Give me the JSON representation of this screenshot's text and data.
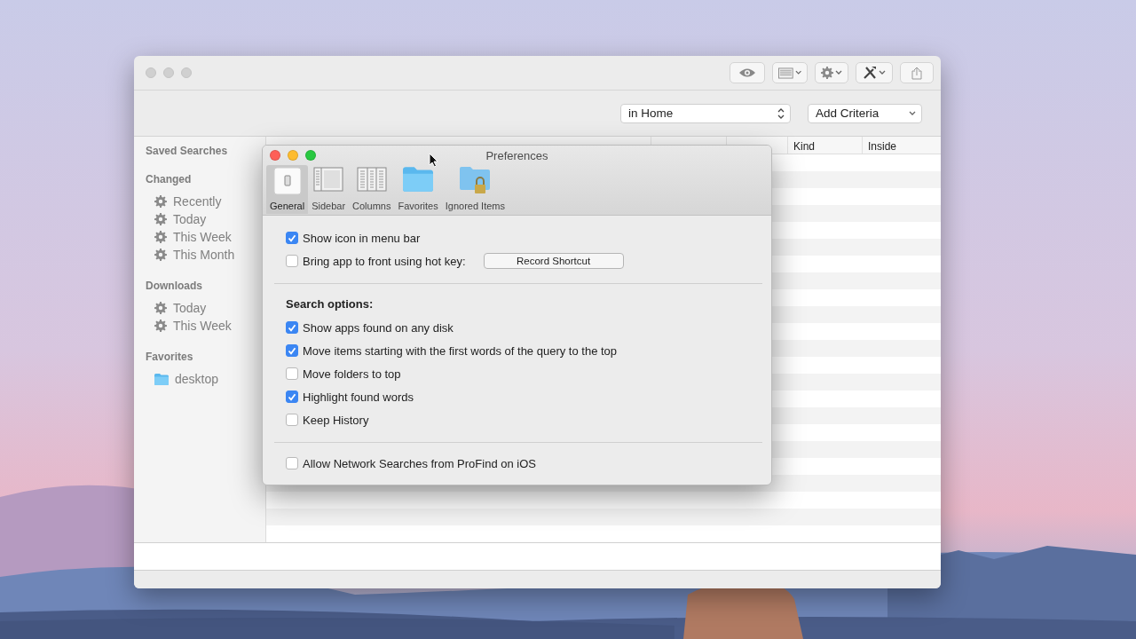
{
  "finder": {
    "scope": "in Home",
    "criteria": "Add Criteria",
    "sidebar": [
      {
        "title": "Saved Searches"
      },
      {
        "title": "Changed",
        "items": [
          {
            "label": "Recently",
            "kind": "search"
          },
          {
            "label": "Today",
            "kind": "search"
          },
          {
            "label": "This Week",
            "kind": "search"
          },
          {
            "label": "This Month",
            "kind": "search"
          }
        ]
      },
      {
        "title": "Downloads",
        "items": [
          {
            "label": "Today",
            "kind": "search"
          },
          {
            "label": "This Week",
            "kind": "search"
          }
        ]
      },
      {
        "title": "Favorites",
        "items": [
          {
            "label": "desktop",
            "kind": "folder"
          }
        ]
      }
    ],
    "columns": [
      "Kind",
      "Inside"
    ]
  },
  "preferences": {
    "title": "Preferences",
    "tabs": [
      {
        "label": "General",
        "selected": true
      },
      {
        "label": "Sidebar",
        "selected": false
      },
      {
        "label": "Columns",
        "selected": false
      },
      {
        "label": "Favorites",
        "selected": false
      },
      {
        "label": "Ignored Items",
        "selected": false
      }
    ],
    "options": [
      {
        "kind": "checkbox",
        "label": "Show icon in menu bar",
        "checked": true
      },
      {
        "kind": "checkbox",
        "label": "Bring app to front using hot key:",
        "checked": false,
        "button": "Record Shortcut"
      },
      {
        "kind": "divider"
      },
      {
        "kind": "heading",
        "label": "Search options:"
      },
      {
        "kind": "checkbox",
        "label": "Show apps found on any disk",
        "checked": true
      },
      {
        "kind": "checkbox",
        "label": "Move items starting with the first words of the query to the top",
        "checked": true
      },
      {
        "kind": "checkbox",
        "label": "Move folders to top",
        "checked": false
      },
      {
        "kind": "checkbox",
        "label": "Highlight found words",
        "checked": true
      },
      {
        "kind": "checkbox",
        "label": "Keep History",
        "checked": false
      },
      {
        "kind": "divider"
      },
      {
        "kind": "checkbox",
        "label": "Allow Network Searches from ProFind on iOS",
        "checked": false
      }
    ]
  }
}
